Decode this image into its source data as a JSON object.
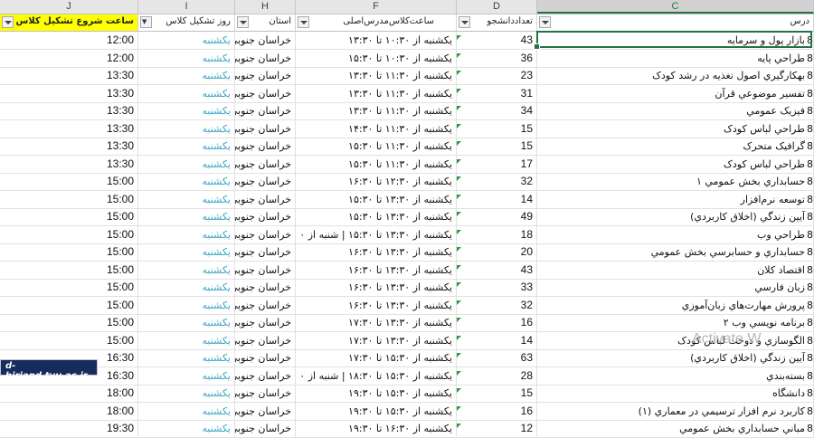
{
  "columns": [
    "J",
    "I",
    "H",
    "F",
    "D",
    "C"
  ],
  "filter_headers": {
    "C": "درس",
    "D": "تعداددانشجو",
    "F": "ساعت‌کلاس‌مدرس‌اصلی",
    "H": "استان",
    "I": "روز تشکیل کلاس",
    "J": "ساعت شروع تشکیل کلاس"
  },
  "rows": [
    {
      "time": "12:00",
      "day": "یکشنبه",
      "province": "خراسان جنوبی",
      "schedule": "یکشنبه از ۱۰:۳۰ تا ۱۳:۳۰",
      "count": "43",
      "course": "بازار پول و سرمايه"
    },
    {
      "time": "12:00",
      "day": "یکشنبه",
      "province": "خراسان جنوبی",
      "schedule": "یکشنبه از ۱۰:۳۰ تا ۱۵:۳۰",
      "count": "36",
      "course": "طراحي پايه"
    },
    {
      "time": "13:30",
      "day": "یکشنبه",
      "province": "خراسان جنوبی",
      "schedule": "یکشنبه از ۱۱:۳۰ تا ۱۳:۳۰",
      "count": "23",
      "course": "بهکارگيري اصول تغذيه در رشد کودک"
    },
    {
      "time": "13:30",
      "day": "یکشنبه",
      "province": "خراسان جنوبی",
      "schedule": "یکشنبه از ۱۱:۳۰ تا ۱۳:۳۰",
      "count": "31",
      "course": "تفسير موضوعي قرآن"
    },
    {
      "time": "13:30",
      "day": "یکشنبه",
      "province": "خراسان جنوبی",
      "schedule": "یکشنبه از ۱۱:۳۰ تا ۱۳:۳۰",
      "count": "34",
      "course": "فيزيک عمومي"
    },
    {
      "time": "13:30",
      "day": "یکشنبه",
      "province": "خراسان جنوبی",
      "schedule": "یکشنبه از ۱۱:۳۰ تا ۱۴:۳۰",
      "count": "15",
      "course": "طراحي لباس کودک"
    },
    {
      "time": "13:30",
      "day": "یکشنبه",
      "province": "خراسان جنوبی",
      "schedule": "یکشنبه از ۱۱:۳۰ تا ۱۵:۳۰",
      "count": "15",
      "course": "گرافيک متحرک"
    },
    {
      "time": "13:30",
      "day": "یکشنبه",
      "province": "خراسان جنوبی",
      "schedule": "یکشنبه از ۱۱:۳۰ تا ۱۵:۳۰",
      "count": "17",
      "course": "طراحي لباس کودک"
    },
    {
      "time": "15:00",
      "day": "یکشنبه",
      "province": "خراسان جنوبی",
      "schedule": "یکشنبه از ۱۲:۳۰ تا ۱۶:۳۰",
      "count": "32",
      "course": "حسابداري بخش عمومي ۱"
    },
    {
      "time": "15:00",
      "day": "یکشنبه",
      "province": "خراسان جنوبی",
      "schedule": "یکشنبه از ۱۳:۳۰ تا ۱۵:۳۰",
      "count": "14",
      "course": "توسعه نرم‌افزار"
    },
    {
      "time": "15:00",
      "day": "یکشنبه",
      "province": "خراسان جنوبی",
      "schedule": "یکشنبه از ۱۳:۳۰ تا ۱۵:۳۰",
      "count": "49",
      "course": "آيين زندگي (اخلاق کاربردي)"
    },
    {
      "time": "15:00",
      "day": "یکشنبه",
      "province": "خراسان جنوبی",
      "schedule": "یکشنبه از ۱۳:۳۰ تا ۱۵:۳۰ | شنبه از ۰",
      "count": "18",
      "course": "طراحي وب"
    },
    {
      "time": "15:00",
      "day": "یکشنبه",
      "province": "خراسان جنوبی",
      "schedule": "یکشنبه از ۱۳:۳۰ تا ۱۶:۳۰",
      "count": "20",
      "course": "حسابداري و حسابرسي بخش عمومي"
    },
    {
      "time": "15:00",
      "day": "یکشنبه",
      "province": "خراسان جنوبی",
      "schedule": "یکشنبه از ۱۳:۳۰ تا ۱۶:۳۰",
      "count": "43",
      "course": "اقتصاد کلان"
    },
    {
      "time": "15:00",
      "day": "یکشنبه",
      "province": "خراسان جنوبی",
      "schedule": "یکشنبه از ۱۳:۳۰ تا ۱۶:۳۰",
      "count": "33",
      "course": "زبان فارسي"
    },
    {
      "time": "15:00",
      "day": "یکشنبه",
      "province": "خراسان جنوبی",
      "schedule": "یکشنبه از ۱۳:۳۰ تا ۱۶:۳۰",
      "count": "32",
      "course": "پرورش مهارت‌هاي زبان‌آموزي"
    },
    {
      "time": "15:00",
      "day": "یکشنبه",
      "province": "خراسان جنوبی",
      "schedule": "یکشنبه از ۱۳:۳۰ تا ۱۷:۳۰",
      "count": "16",
      "course": "برنامه نويسي وب ۲"
    },
    {
      "time": "15:00",
      "day": "یکشنبه",
      "province": "خراسان جنوبی",
      "schedule": "یکشنبه از ۱۳:۳۰ تا ۱۷:۳۰",
      "count": "14",
      "course": "الگوسازي و دوخت لباس کودک"
    },
    {
      "time": "16:30",
      "day": "یکشنبه",
      "province": "خراسان جنوبی",
      "schedule": "یکشنبه از ۱۵:۳۰ تا ۱۷:۳۰",
      "count": "63",
      "course": "آيين زندگي (اخلاق کاربردي)"
    },
    {
      "time": "16:30",
      "day": "یکشنبه",
      "province": "خراسان جنوبی",
      "schedule": "یکشنبه از ۱۵:۳۰ تا ۱۸:۳۰ | شنبه از ۰",
      "count": "28",
      "course": "بسته‌بندي"
    },
    {
      "time": "18:00",
      "day": "یکشنبه",
      "province": "خراسان جنوبی",
      "schedule": "یکشنبه از ۱۵:۳۰ تا ۱۹:۳۰",
      "count": "15",
      "course": "دانشگاه"
    },
    {
      "time": "18:00",
      "day": "یکشنبه",
      "province": "خراسان جنوبی",
      "schedule": "یکشنبه از ۱۵:۳۰ تا ۱۹:۳۰",
      "count": "16",
      "course": "کاربرد نرم افزار ترسيمي در معماري (۱)"
    },
    {
      "time": "19:30",
      "day": "یکشنبه",
      "province": "خراسان جنوبی",
      "schedule": "یکشنبه از ۱۶:۳۰ تا ۱۹:۳۰",
      "count": "12",
      "course": "مباني حسابداري بخش عمومي"
    }
  ],
  "row_edge_char": "8",
  "watermark": "Activate W",
  "logo_text": "d-birjand.tvu.ac.ir",
  "colors": {
    "header_bg": "#e6e6e6",
    "selected_accent": "#217346",
    "highlight_yellow": "#ffff00",
    "link_cyan": "#3aa4c4",
    "marker_green": "#2e9a3a",
    "logo_bg": "#152c5c"
  }
}
